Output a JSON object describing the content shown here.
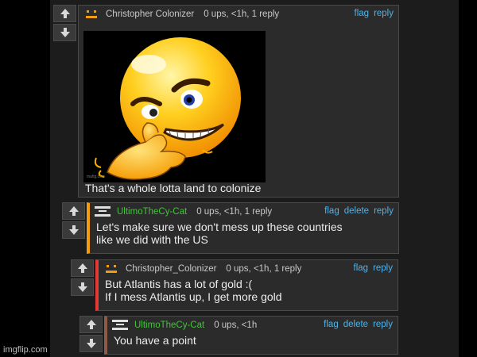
{
  "votes": {
    "up_icon": "arrow-up-icon",
    "down_icon": "arrow-down-icon"
  },
  "comments": [
    {
      "username": "Christopher  Colonizer",
      "meta": "0 ups, <1h, 1 reply",
      "actions": [
        "flag",
        "reply"
      ],
      "text_lines": [
        "That's a whole lotta land to colonize"
      ],
      "image_tag": "mafig.com"
    },
    {
      "username": "UltimoTheCy-Cat",
      "meta": "0 ups, <1h, 1 reply",
      "actions": [
        "flag",
        "delete",
        "reply"
      ],
      "text_lines": [
        "Let's make sure we don't mess up these countries",
        "like we did with the US"
      ]
    },
    {
      "username": "Christopher_Colonizer",
      "meta": "0 ups, <1h, 1 reply",
      "actions": [
        "flag",
        "reply"
      ],
      "text_lines": [
        "But Atlantis has a lot of gold :(",
        "If I mess Atlantis up, I get more gold"
      ]
    },
    {
      "username": "UltimoTheCy-Cat",
      "meta": "0 ups, <1h",
      "actions": [
        "flag",
        "delete",
        "reply"
      ],
      "text_lines": [
        "You have a point"
      ]
    }
  ],
  "watermark": "imgflip.com",
  "colors": {
    "orange_bar": "#f39c12",
    "red_bar": "#e53935",
    "brown_bar": "#8d5a4a",
    "link": "#4fb3ea",
    "user_green": "#46c13e"
  }
}
